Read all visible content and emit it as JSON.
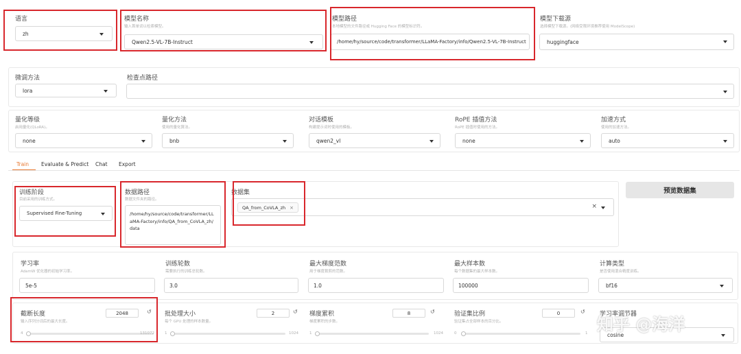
{
  "row1": {
    "language": {
      "label": "语言",
      "value": "zh"
    },
    "model_name": {
      "label": "模型名称",
      "sub": "输入首单词以检索模型。",
      "value": "Qwen2.5-VL-7B-Instruct"
    },
    "model_path": {
      "label": "模型路径",
      "sub": "本地模型的文件路径或 Hugging Face 的模型标识符。",
      "value": "/home/hy/source/code/transformer/LLaMA-Factory/info/Qwen2.5-VL-7B-Instruct"
    },
    "model_source": {
      "label": "模型下载源",
      "sub": "选择模型下载源。(网络受限环境推荐使用 ModelScope)",
      "value": "huggingface"
    }
  },
  "row2": {
    "finetune": {
      "label": "微调方法",
      "value": "lora"
    },
    "checkpoint": {
      "label": "检查点路径",
      "value": ""
    }
  },
  "row3": {
    "quant_bit": {
      "label": "量化等级",
      "sub": "启用量化(QLoRA)。",
      "value": "none"
    },
    "quant_method": {
      "label": "量化方法",
      "sub": "使用的量化算法。",
      "value": "bnb"
    },
    "template": {
      "label": "对话模板",
      "sub": "构建提示词时使用的模板。",
      "value": "qwen2_vl"
    },
    "rope": {
      "label": "RoPE 插值方法",
      "sub": "RoPE 插值时使用的方法。",
      "value": "none"
    },
    "booster": {
      "label": "加速方式",
      "sub": "使用的加速方法。",
      "value": "auto"
    }
  },
  "tabs": [
    "Train",
    "Evaluate & Predict",
    "Chat",
    "Export"
  ],
  "train": {
    "stage": {
      "label": "训练阶段",
      "sub": "目前采用的训练方式。",
      "value": "Supervised Fine-Tuning"
    },
    "dataset_dir": {
      "label": "数据路径",
      "sub": "数据文件夹的路径。",
      "value": "/home/hy/source/code/transformer/LLaMA-Factory/info/QA_from_CoVLA_zh/data"
    },
    "dataset": {
      "label": "数据集",
      "chip": "QA_from_CoVLA_zh",
      "chip_close": "×",
      "clear": "×"
    },
    "preview_button": "预览数据集"
  },
  "row5": {
    "lr": {
      "label": "学习率",
      "sub": "AdamW 优化器的初始学习率。",
      "value": "5e-5"
    },
    "epochs": {
      "label": "训练轮数",
      "sub": "需要执行的训练总轮数。",
      "value": "3.0"
    },
    "grad_norm": {
      "label": "最大梯度范数",
      "sub": "用于梯度裁剪的范数。",
      "value": "1.0"
    },
    "max_samples": {
      "label": "最大样本数",
      "sub": "每个数据集的最大样本数。",
      "value": "100000"
    },
    "compute_type": {
      "label": "计算类型",
      "sub": "是否使用混合精度训练。",
      "value": "bf16"
    }
  },
  "row6": {
    "cutoff": {
      "label": "截断长度",
      "sub": "输入序列分词后的最大长度。",
      "value": "2048",
      "min": "4",
      "max": "131072",
      "level": 0.016
    },
    "batch": {
      "label": "批处理大小",
      "sub": "每个 GPU 处理的样本数量。",
      "value": "2",
      "min": "1",
      "max": "1024",
      "level": 0.001
    },
    "grad_accum": {
      "label": "梯度累积",
      "sub": "梯度累积的步数。",
      "value": "8",
      "min": "1",
      "max": "1024",
      "level": 0.007
    },
    "val_size": {
      "label": "验证集比例",
      "sub": "验证集占全部样本的百分比。",
      "value": "0",
      "min": "0",
      "max": "1",
      "level": 0
    },
    "scheduler": {
      "label": "学习率调节器",
      "value": "cosine"
    },
    "reset_icon": "↺"
  },
  "watermark": "知乎 @海洋"
}
